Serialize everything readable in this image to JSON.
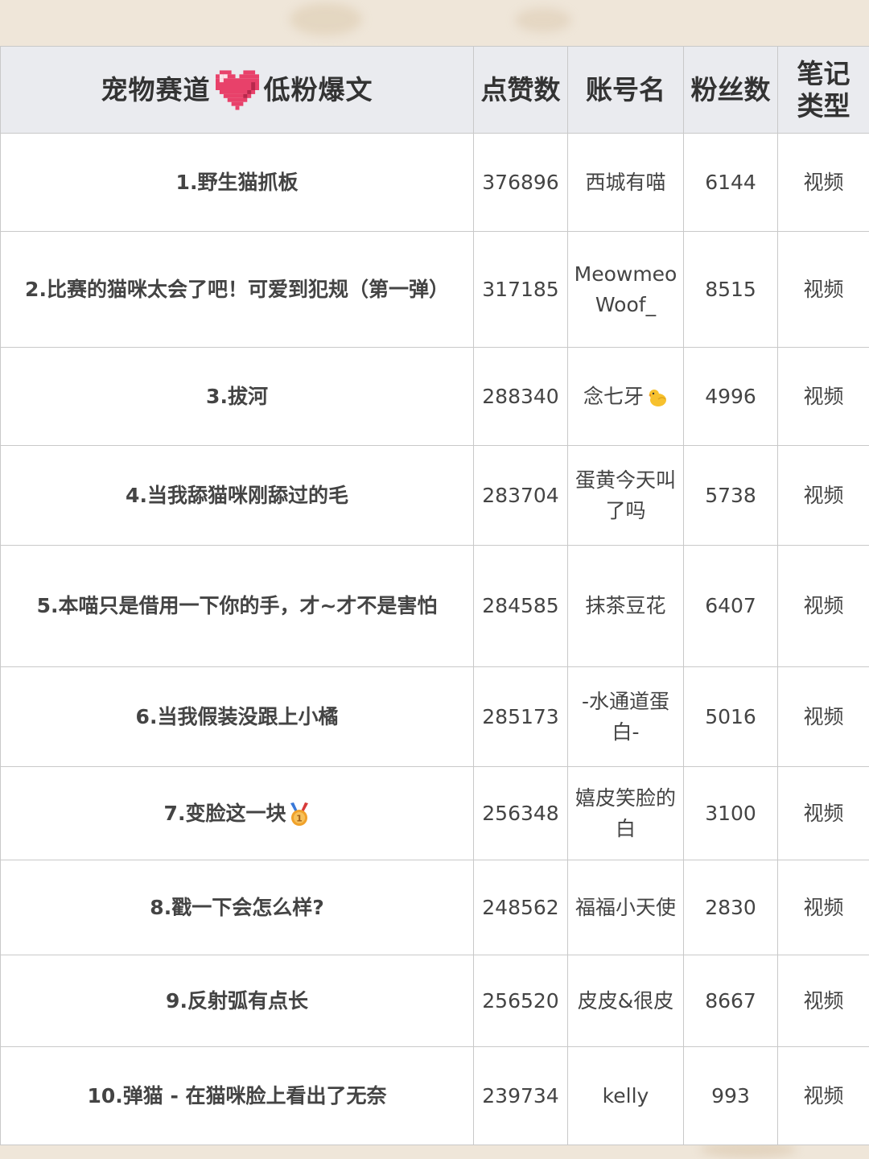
{
  "table": {
    "header": {
      "title_part1": "宠物赛道",
      "heart_icon": "pixel-heart-icon",
      "title_part2": "低粉爆文",
      "likes": "点赞数",
      "account": "账号名",
      "fans": "粉丝数",
      "type": "笔记类型"
    },
    "rows": [
      {
        "title": "1.野生猫抓板",
        "likes": "376896",
        "account": "西城有喵",
        "fans": "6144",
        "type": "视频"
      },
      {
        "title": "2.比赛的猫咪太会了吧！可爱到犯规（第一弹）",
        "likes": "317185",
        "account": "MeowmeoWoof_",
        "fans": "8515",
        "type": "视频"
      },
      {
        "title": "3.拔河",
        "likes": "288340",
        "account": "念七牙",
        "account_icon": "chick-icon",
        "fans": "4996",
        "type": "视频"
      },
      {
        "title": "4.当我舔猫咪刚舔过的毛",
        "likes": "283704",
        "account": "蛋黄今天叫了吗",
        "fans": "5738",
        "type": "视频"
      },
      {
        "title": "5.本喵只是借用一下你的手，才~才不是害怕",
        "likes": "284585",
        "account": "抹茶豆花",
        "fans": "6407",
        "type": "视频"
      },
      {
        "title": "6.当我假装没跟上小橘",
        "likes": "285173",
        "account": "-水通道蛋白-",
        "fans": "5016",
        "type": "视频"
      },
      {
        "title": "7.变脸这一块",
        "title_icon": "medal-icon",
        "likes": "256348",
        "account": "嬉皮笑脸的白",
        "fans": "3100",
        "type": "视频"
      },
      {
        "title": "8.戳一下会怎么样?",
        "likes": "248562",
        "account": "福福小天使",
        "fans": "2830",
        "type": "视频"
      },
      {
        "title": "9.反射弧有点长",
        "likes": "256520",
        "account": "皮皮&很皮",
        "fans": "8667",
        "type": "视频"
      },
      {
        "title": "10.弹猫 - 在猫咪脸上看出了无奈",
        "likes": "239734",
        "account": "kelly",
        "fans": "993",
        "type": "视频"
      }
    ]
  },
  "colors": {
    "background": "#efe6d9",
    "header_bg": "#eaebef",
    "heart": "#e8416a",
    "border": "#c9c9c9"
  }
}
